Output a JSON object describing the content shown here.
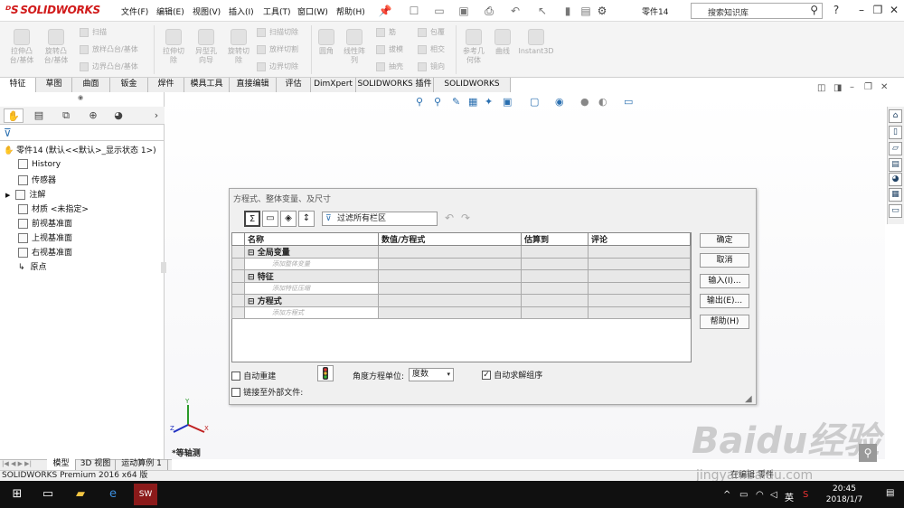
{
  "app": {
    "logo": "SOLIDWORKS",
    "doc_name": "零件14"
  },
  "menu": [
    "文件(F)",
    "编辑(E)",
    "视图(V)",
    "插入(I)",
    "工具(T)",
    "窗口(W)",
    "帮助(H)"
  ],
  "search": {
    "placeholder": "搜索知识库"
  },
  "ribbon": {
    "big": [
      {
        "label": "拉伸凸\n台/基体"
      },
      {
        "label": "旋转凸\n台/基体"
      },
      {
        "label": "拉伸切\n除"
      },
      {
        "label": "异型孔\n向导"
      },
      {
        "label": "旋转切\n除"
      },
      {
        "label": "圆角"
      },
      {
        "label": "线性阵\n列"
      },
      {
        "label": "参考几\n何体"
      },
      {
        "label": "曲线"
      },
      {
        "label": "Instant3D"
      }
    ],
    "small1": [
      "扫描",
      "放样凸台/基体",
      "边界凸台/基体"
    ],
    "small2": [
      "扫描切除",
      "放样切割",
      "边界切除"
    ],
    "small3": [
      "筋",
      "拔模",
      "抽壳"
    ],
    "small4": [
      "包覆",
      "相交",
      "镜向"
    ]
  },
  "tabs": [
    "特征",
    "草图",
    "曲面",
    "钣金",
    "焊件",
    "模具工具",
    "直接编辑",
    "评估",
    "DimXpert",
    "SOLIDWORKS 插件",
    "SOLIDWORKS MBD"
  ],
  "tree": {
    "root": "零件14 (默认<<默认>_显示状态 1>)",
    "items": [
      "History",
      "传感器",
      "注解",
      "材质 <未指定>",
      "前视基准面",
      "上视基准面",
      "右视基准面",
      "原点"
    ]
  },
  "dialog": {
    "title": "方程式、整体变量、及尺寸",
    "filter": "过滤所有栏区",
    "columns": [
      "名称",
      "数值/方程式",
      "估算到",
      "评论"
    ],
    "sections": [
      {
        "name": "全局变量",
        "hint": "添加整体变量"
      },
      {
        "name": "特征",
        "hint": "添加特征压缩"
      },
      {
        "name": "方程式",
        "hint": "添加方程式"
      }
    ],
    "buttons": [
      "确定",
      "取消",
      "输入(I)...",
      "输出(E)...",
      "帮助(H)"
    ],
    "auto_rebuild": "自动重建",
    "angle_unit_label": "角度方程单位:",
    "angle_unit_value": "度数",
    "auto_solve": "自动求解组序",
    "link_external": "链接至外部文件:"
  },
  "viewport": {
    "view_name": "*等轴测",
    "triad": {
      "x": "X",
      "y": "Y",
      "z": "Z"
    }
  },
  "bottom_tabs": [
    "模型",
    "3D 视图",
    "运动算例 1"
  ],
  "status": {
    "left": "SOLIDWORKS Premium 2016 x64 版",
    "right": "在编辑 零件"
  },
  "taskbar": {
    "time": "20:45",
    "date": "2018/1/7",
    "ime": "英"
  },
  "watermark": {
    "text": "Baidu经验",
    "url": "jingyan.baidu.com"
  },
  "colors": {
    "brand": "#d11a1a",
    "taskbar": "#101010",
    "accent": "#2a6fb0"
  }
}
